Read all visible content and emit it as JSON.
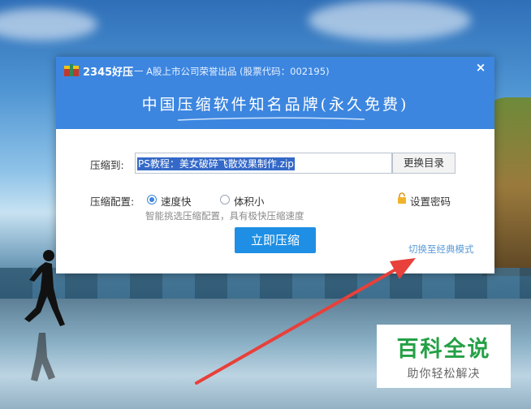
{
  "dialog": {
    "app_name": "2345好压",
    "subtitle": "一 A股上市公司荣誉出品 (股票代码：002195)",
    "close_symbol": "×",
    "slogan": "中国压缩软件知名品牌(永久免费)",
    "compress_to_label": "压缩到:",
    "path_value": "PS教程：美女破碎飞散效果制作.zip",
    "change_dir_label": "更换目录",
    "config_label": "压缩配置:",
    "option_fast": "速度快",
    "option_small": "体积小",
    "selected_option": "速度快",
    "set_password_label": "设置密码",
    "hint": "智能挑选压缩配置，具有极快压缩速度",
    "compress_now_label": "立即压缩",
    "classic_mode_link": "切换至经典模式"
  },
  "watermark": {
    "main": "百科全说",
    "sub": "助你轻松解决"
  },
  "colors": {
    "header": "#3c86e0",
    "primary_button": "#1e8fe4",
    "link": "#5a9ad8",
    "arrow": "#e8403a",
    "watermark_text": "#25a046"
  }
}
